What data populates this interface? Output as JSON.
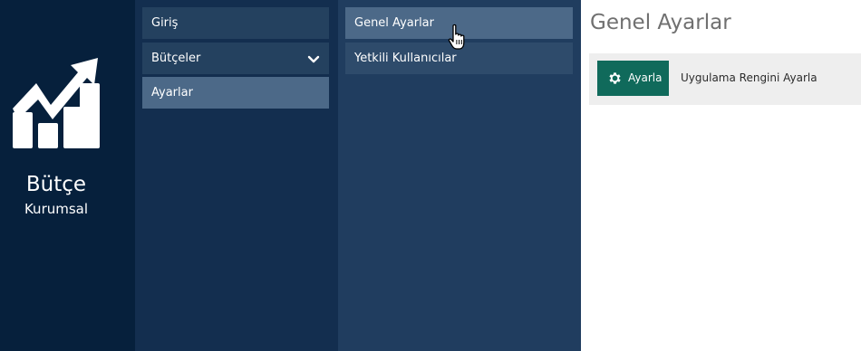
{
  "brand": {
    "title": "Bütçe",
    "subtitle": "Kurumsal",
    "logo_icon": "growth-chart-icon"
  },
  "menu_main": {
    "items": [
      {
        "label": "Giriş"
      },
      {
        "label": "Bütçeler",
        "icon": "chevron-down-icon"
      },
      {
        "label": "Ayarlar",
        "active": true
      }
    ]
  },
  "menu_settings": {
    "items": [
      {
        "label": "Genel Ayarlar",
        "hover": true
      },
      {
        "label": "Yetkili Kullanıcılar"
      }
    ]
  },
  "content": {
    "title": "Genel Ayarlar",
    "setting": {
      "button_label": "Ayarla",
      "button_icon": "gear-icon",
      "description": "Uygulama Rengini Ayarla"
    }
  },
  "colors": {
    "brand_bg": "#06203c",
    "menu_bg": "#132e4f",
    "submenu_bg": "#203d5f",
    "active_item": "#4c6988",
    "button_bg": "#106a5b"
  }
}
